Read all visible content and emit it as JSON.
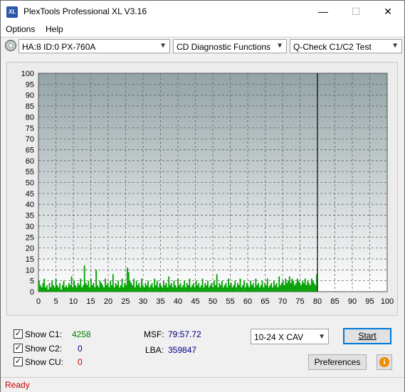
{
  "window": {
    "title": "PlexTools Professional XL V3.16",
    "app_icon": "XL",
    "controls": {
      "minimize": "—",
      "maximize": "☐",
      "close": "✕"
    }
  },
  "menu": {
    "options": "Options",
    "help": "Help"
  },
  "toolbar": {
    "drive": "HA:8 ID:0  PX-760A",
    "function": "CD Diagnostic Functions",
    "test": "Q-Check C1/C2 Test"
  },
  "colors": {
    "plot_bg_top": "#93a3a6",
    "plot_bg_bottom": "#ffffff",
    "c1_series": "#00a000",
    "c1_value": "#008000",
    "c2_value": "#000080",
    "cu_value": "#cc0000",
    "status": "#cc0000"
  },
  "chart_data": {
    "type": "bar",
    "x_ticks": [
      0,
      5,
      10,
      15,
      20,
      25,
      30,
      35,
      40,
      45,
      50,
      55,
      60,
      65,
      70,
      75,
      80,
      85,
      90,
      95,
      100
    ],
    "y_ticks": [
      0,
      5,
      10,
      15,
      20,
      25,
      30,
      35,
      40,
      45,
      50,
      55,
      60,
      65,
      70,
      75,
      80,
      85,
      90,
      95,
      100
    ],
    "xlim": [
      0,
      100
    ],
    "ylim": [
      0,
      100
    ],
    "grid": true,
    "end_marker_x": 80,
    "series": [
      {
        "values": [
          5,
          3,
          2,
          4,
          6,
          2,
          3,
          1,
          4,
          2,
          5,
          3,
          2,
          6,
          3,
          2,
          4,
          1,
          3,
          5,
          2,
          3,
          2,
          4,
          3,
          7,
          2,
          5,
          3,
          2,
          4,
          3,
          6,
          2,
          3,
          12,
          4,
          3,
          5,
          2,
          6,
          3,
          4,
          2,
          10,
          3,
          2,
          5,
          4,
          3,
          2,
          6,
          3,
          4,
          2,
          5,
          3,
          8,
          2,
          4,
          3,
          5,
          2,
          3,
          6,
          2,
          4,
          3,
          11,
          9,
          5,
          4,
          3,
          6,
          2,
          5,
          3,
          4,
          2,
          6,
          3,
          2,
          4,
          3,
          5,
          2,
          3,
          4,
          2,
          6,
          3,
          5,
          2,
          4,
          3,
          2,
          5,
          3,
          4,
          2,
          7,
          3,
          4,
          2,
          5,
          3,
          2,
          6,
          3,
          4,
          2,
          3,
          5,
          2,
          4,
          3,
          6,
          2,
          3,
          4,
          2,
          5,
          3,
          4,
          2,
          3,
          6,
          2,
          4,
          3,
          5,
          2,
          3,
          4,
          2,
          5,
          3,
          8,
          2,
          4,
          3,
          5,
          2,
          3,
          4,
          2,
          6,
          3,
          4,
          2,
          3,
          5,
          2,
          4,
          3,
          6,
          2,
          3,
          5,
          2,
          4,
          3,
          2,
          5,
          3,
          4,
          2,
          6,
          3,
          4,
          2,
          3,
          5,
          2,
          4,
          3,
          6,
          2,
          3,
          4,
          2,
          5,
          3,
          4,
          2,
          7,
          3,
          4,
          5,
          3,
          6,
          4,
          5,
          7,
          4,
          6,
          5,
          3,
          4,
          6,
          5,
          4,
          3,
          5,
          4,
          6,
          3,
          5,
          4,
          3,
          6,
          5,
          4,
          3,
          8
        ]
      }
    ]
  },
  "stats": {
    "c1_label": "Show C1:",
    "c1_value": "4258",
    "c2_label": "Show C2:",
    "c2_value": "0",
    "cu_label": "Show CU:",
    "cu_value": "0",
    "msf_label": "MSF:",
    "msf_value": "79:57.72",
    "lba_label": "LBA:",
    "lba_value": "359847"
  },
  "controls": {
    "speed": "10-24 X CAV",
    "start": "Start",
    "preferences": "Preferences",
    "info_glyph": "i"
  },
  "status": {
    "text": "Ready"
  }
}
